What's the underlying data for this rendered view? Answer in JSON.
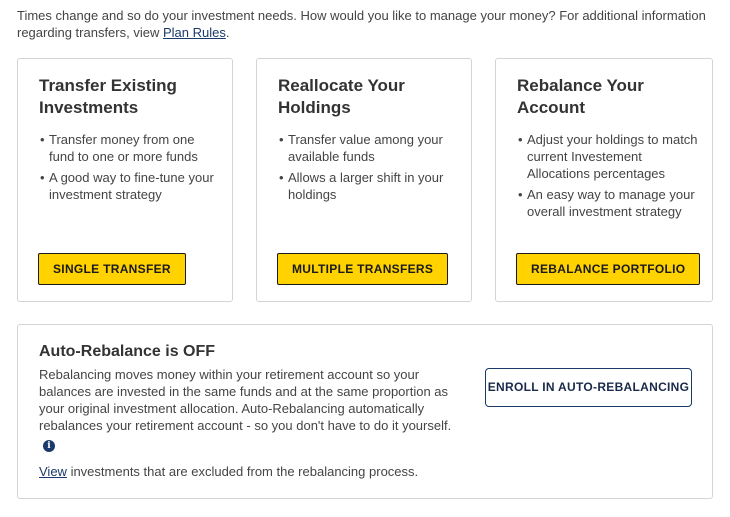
{
  "intro": {
    "text": "Times change and so do your investment needs. How would you like to manage your money? For additional information regarding transfers, view ",
    "link": "Plan Rules",
    "end": "."
  },
  "cards": [
    {
      "title": "Transfer Existing Investments",
      "bullets": [
        "Transfer money from one fund to one or more funds",
        "A good way to fine-tune your investment strategy"
      ],
      "button": "SINGLE TRANSFER"
    },
    {
      "title": "Reallocate Your Holdings",
      "bullets": [
        "Transfer value among your available funds",
        "Allows a larger shift in your holdings"
      ],
      "button": "MULTIPLE TRANSFERS"
    },
    {
      "title": "Rebalance Your Account",
      "bullets": [
        "Adjust your holdings to match current Investement Allocations percentages",
        "An easy way to manage your overall investment strategy"
      ],
      "button": "REBALANCE PORTFOLIO"
    }
  ],
  "auto": {
    "title": "Auto-Rebalance is OFF",
    "description": "Rebalancing moves money within your retirement account so your balances are invested in the same funds and at the same proportion as your original investment allocation. Auto-Rebalancing automatically rebalances your retirement account - so you don't have to do it yourself.",
    "info_icon": "i",
    "view_link": "View",
    "view_text": " investments that are excluded from the rebalancing process.",
    "enroll_button": "ENROLL IN AUTO-REBALANCING"
  },
  "colors": {
    "accent_yellow": "#ffd200",
    "link_navy": "#1a3a6b"
  }
}
